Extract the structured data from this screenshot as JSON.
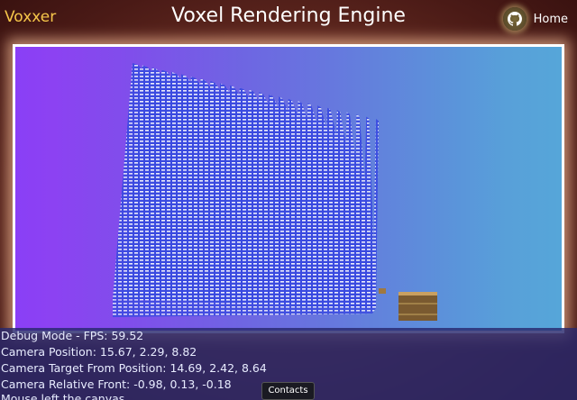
{
  "header": {
    "brand": "Voxxer",
    "title": "Voxel Rendering Engine",
    "home_label": "Home"
  },
  "canvas": {
    "description_icon": "voxel-scene"
  },
  "debug": {
    "mode_line": "Debug Mode - FPS: 59.52",
    "camera_position": "Camera Position: 15.67, 2.29, 8.82",
    "camera_target": "Camera Target From Position: 14.69, 2.42, 8.64",
    "camera_front": "Camera Relative Front: -0.98, 0.13, -0.18",
    "mouse_status": "Mouse left the canvas"
  },
  "footer": {
    "contacts_label": "Contacts"
  },
  "colors": {
    "brand": "#f6c64a",
    "background": "#6a2f24"
  }
}
